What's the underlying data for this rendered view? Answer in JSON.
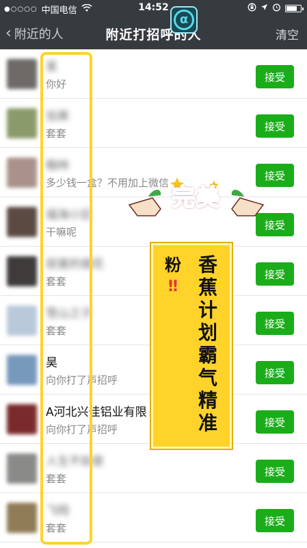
{
  "status_bar": {
    "signal": "●○○○○",
    "carrier": "中国电信",
    "wifi_icon": "wifi-icon",
    "time": "14:52",
    "right_icons": [
      "orientation-lock-icon",
      "location-icon",
      "alarm-icon",
      "battery-icon"
    ]
  },
  "nav": {
    "back_label": "附近的人",
    "title": "附近打招呼的人",
    "clear_label": "清空"
  },
  "list": [
    {
      "name": "某",
      "message": "你好",
      "accept": "接受",
      "name_blurred": true,
      "avatar_color": "#6d6a68"
    },
    {
      "name": "加美",
      "message": "套套",
      "accept": "接受",
      "name_blurred": true,
      "avatar_color": "#8b9a6a"
    },
    {
      "name": "翰林",
      "message": "多少钱一盒？不用加上微信",
      "accept": "接受",
      "name_blurred": true,
      "avatar_color": "#a9928a"
    },
    {
      "name": "福海小区",
      "message": "干嘛呢",
      "accept": "接受",
      "name_blurred": true,
      "avatar_color": "#5a4a42"
    },
    {
      "name": "寂寞的烟花",
      "message": "套套",
      "accept": "接受",
      "name_blurred": true,
      "avatar_color": "#3e3b3a"
    },
    {
      "name": "雪山之子",
      "message": "套套",
      "accept": "接受",
      "name_blurred": true,
      "avatar_color": "#b9c9d9"
    },
    {
      "name": "昊",
      "message": "向你打了声招呼",
      "accept": "接受",
      "name_blurred": false,
      "avatar_color": "#7799bb"
    },
    {
      "name": "A河北兴佳铝业有限",
      "message": "向你打了声招呼",
      "accept": "接受",
      "name_blurred": false,
      "avatar_color": "#7a2a2a"
    },
    {
      "name": "人生不如意",
      "message": "套套",
      "accept": "接受",
      "name_blurred": true,
      "avatar_color": "#8a8a88"
    },
    {
      "name": "飞翔",
      "message": "套套",
      "accept": "接受",
      "name_blurred": true,
      "avatar_color": "#8f7b55"
    }
  ],
  "overlay": {
    "sticker_text": "完美",
    "banner_col1": [
      "粉",
      "‼"
    ],
    "banner_col2": [
      "香",
      "蕉",
      "计",
      "划",
      "霸",
      "气",
      "精",
      "准"
    ],
    "app_icon_glyph": "α"
  },
  "colors": {
    "nav_bg": "#363b40",
    "accept_green": "#1aad19",
    "highlight_yellow": "#ffd32a",
    "sticker_red": "#e8334a"
  }
}
